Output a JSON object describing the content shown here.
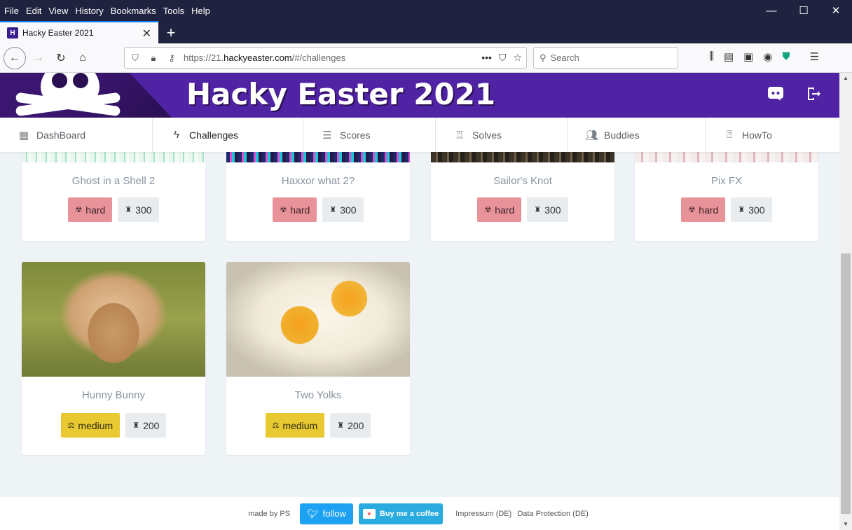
{
  "browser": {
    "menu": [
      "File",
      "Edit",
      "View",
      "History",
      "Bookmarks",
      "Tools",
      "Help"
    ],
    "tab_title": "Hacky Easter 2021",
    "url_prefix": "https://21.",
    "url_domain": "hackyeaster.com",
    "url_path": "/#/challenges",
    "search_placeholder": "Search",
    "minimize_glyph": "—",
    "maximize_glyph": "☐",
    "close_glyph": "✕",
    "new_tab_glyph": "+",
    "tab_close_glyph": "✕",
    "favicon_letter": "H"
  },
  "site": {
    "title": "Hacky Easter 2021",
    "nav": [
      {
        "label": "DashBoard",
        "icon": "dashboard-icon"
      },
      {
        "label": "Challenges",
        "icon": "bolt-icon"
      },
      {
        "label": "Scores",
        "icon": "list-icon"
      },
      {
        "label": "Solves",
        "icon": "trophy-icon"
      },
      {
        "label": "Buddies",
        "icon": "people-icon"
      },
      {
        "label": "HowTo",
        "icon": "help-icon"
      }
    ],
    "active_nav": "Challenges"
  },
  "challenges": [
    {
      "title": "Ghost in a Shell 2",
      "difficulty": "hard",
      "points": "300",
      "image": "matrix-image"
    },
    {
      "title": "Haxxor what 2?",
      "difficulty": "hard",
      "points": "300",
      "image": "neon-image"
    },
    {
      "title": "Sailor's Knot",
      "difficulty": "hard",
      "points": "300",
      "image": "rope-image"
    },
    {
      "title": "Pix FX",
      "difficulty": "hard",
      "points": "300",
      "image": "pixels-image"
    },
    {
      "title": "Hunny Bunny",
      "difficulty": "medium",
      "points": "200",
      "image": "bunny-image"
    },
    {
      "title": "Two Yolks",
      "difficulty": "medium",
      "points": "200",
      "image": "eggs-image"
    }
  ],
  "footer": {
    "made_by": "made by PS",
    "follow": "follow",
    "coffee": "Buy me a coffee",
    "impressum": "Impressum (DE)",
    "privacy": "Data Protection (DE)"
  },
  "colors": {
    "header": "#5023a4",
    "hard": "#e8929a",
    "medium": "#e8c931",
    "points": "#e9ecef",
    "twitter": "#1da1f2",
    "coffee": "#29abe0"
  }
}
